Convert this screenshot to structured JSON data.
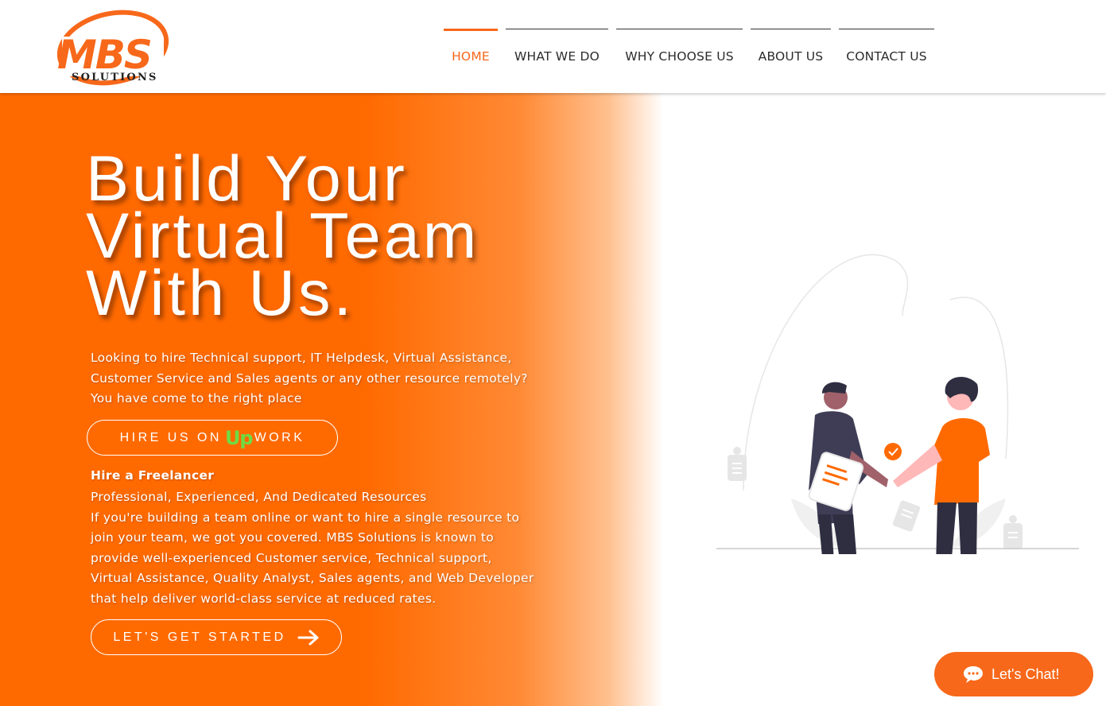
{
  "brand": {
    "logo_main": "MBS",
    "logo_sub": "SOLUTIONS",
    "accent": "#f7681a"
  },
  "nav": {
    "items": [
      {
        "label": "HOME",
        "active": true
      },
      {
        "label": "WHAT WE DO",
        "active": false
      },
      {
        "label": "WHY CHOOSE US",
        "active": false
      },
      {
        "label": "ABOUT US",
        "active": false
      },
      {
        "label": "CONTACT US",
        "active": false
      }
    ]
  },
  "hero": {
    "headline": [
      "Build Your",
      "Virtual Team",
      "With Us."
    ],
    "intro": "Looking to hire Technical support, IT Helpdesk, Virtual Assistance, Customer Service and Sales agents or any other resource remotely? You have come to the right place",
    "upwork_button": {
      "label": "HIRE US ON",
      "logo_up": "Up",
      "logo_rest": "WORK"
    },
    "subheading": "Hire a Freelancer",
    "tagline": "Professional, Experienced, And Dedicated Resources",
    "body": "If you're building a team online or want to hire a single resource to join your team, we got you covered. MBS Solutions is known to provide well-experienced Customer service, Technical support, Virtual Assistance, Quality Analyst, Sales agents, and Web Developer that help deliver world-class service at reduced rates.",
    "cta_label": "LET'S GET STARTED"
  },
  "illustration": {
    "icon": "handshake-illustration",
    "colors": {
      "orange": "#ff6a00",
      "dark": "#2f2e41",
      "skin_dark": "#a0616a",
      "skin_light": "#ffb8b8"
    }
  },
  "chat": {
    "label": "Let's Chat!",
    "icon": "chat-bubble-icon"
  },
  "colors": {
    "hero_orange": "#ff6a00",
    "upwork_green": "#6fda44",
    "text_dark": "#2c2c2c"
  }
}
